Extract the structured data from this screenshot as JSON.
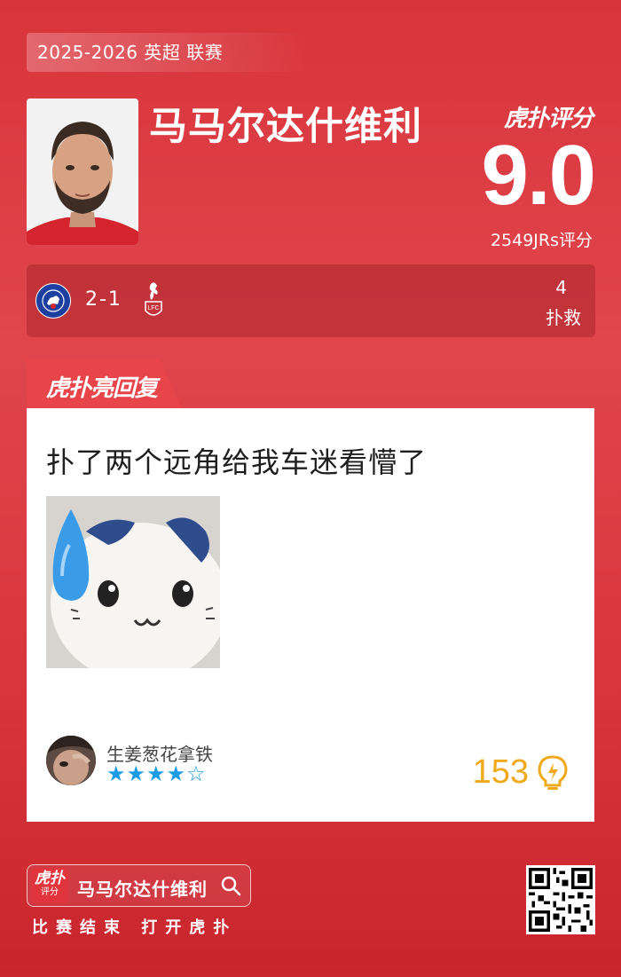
{
  "header": {
    "season": "2025-2026 英超 联赛",
    "player_name": "马马尔达什维利",
    "brand": "虎扑评分",
    "score": "9.0",
    "votes": "2549JRs评分"
  },
  "match": {
    "home_crest": "chelsea-crest",
    "result": "2-1",
    "away_crest": "liverpool-crest",
    "stat_value": "4",
    "stat_label": "扑救"
  },
  "reply": {
    "tag": "虎扑亮回复",
    "comment": "扑了两个远角给我车迷看懵了",
    "image_icon": "crying-cat-meme",
    "username": "生姜葱花拿铁",
    "stars_full": "★★★★",
    "stars_empty": "☆",
    "rating": 4,
    "likes": "153",
    "like_icon": "lightbulb-icon"
  },
  "footer": {
    "logo_main": "虎扑",
    "logo_sub": "评分",
    "search_text": "马马尔达什维利",
    "caption": "比赛结束 打开虎扑",
    "qr_icon": "qr-code"
  },
  "colors": {
    "background": "#d8343b",
    "accent_blue": "#1a9be4",
    "likes_gold": "#f0a91a",
    "card": "#ffffff"
  }
}
